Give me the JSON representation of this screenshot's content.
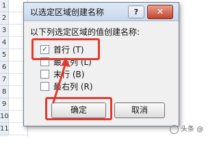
{
  "sheet": {
    "row_glyphs": [
      "1",
      "2",
      "3",
      "4",
      "5",
      "6",
      "7",
      "8",
      "9",
      "10",
      "11"
    ]
  },
  "dialog": {
    "title": "以选定区域创建名称",
    "help_label": "?",
    "close_label": "✕",
    "prompt": "以下列选定区域的值创建名称:",
    "options": [
      {
        "label": "首行 (T)",
        "checked": true
      },
      {
        "label": "最左列 (L)",
        "checked": false
      },
      {
        "label": "末行 (B)",
        "checked": false
      },
      {
        "label": "最右列 (R)",
        "checked": false
      }
    ],
    "ok_label": "确定",
    "cancel_label": "取消"
  },
  "annotation": {
    "highlight_color": "#e03a2e"
  },
  "watermark": {
    "text": "头条 @"
  }
}
